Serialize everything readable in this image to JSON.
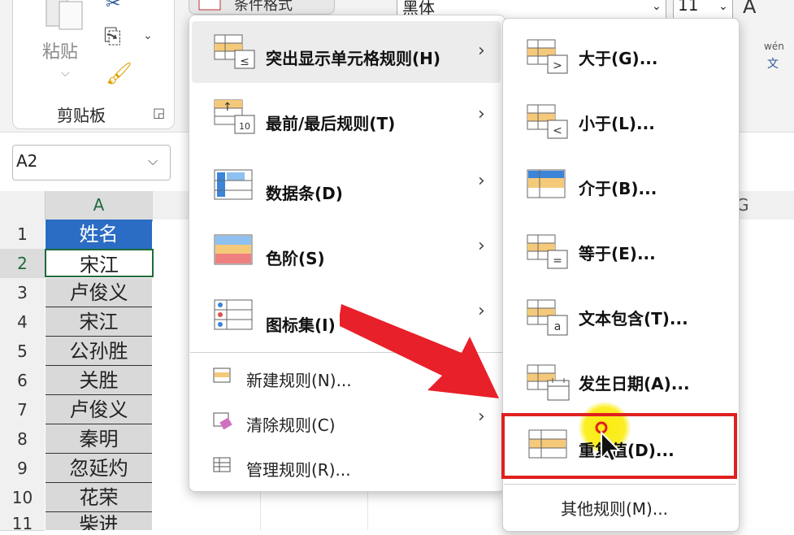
{
  "ribbon": {
    "clipboard": {
      "paste_label": "粘贴",
      "title": "剪贴板"
    },
    "conditional_format_label": "条件格式",
    "font_name": "黑体",
    "font_size": "11",
    "phonetic_top": "wén",
    "phonetic_bottom": "文"
  },
  "name_box": {
    "value": "A2"
  },
  "grid": {
    "col_a": "A",
    "col_g": "G",
    "rows": [
      {
        "num": "1",
        "value": "姓名"
      },
      {
        "num": "2",
        "value": "宋江"
      },
      {
        "num": "3",
        "value": "卢俊义"
      },
      {
        "num": "4",
        "value": "宋江"
      },
      {
        "num": "5",
        "value": "公孙胜"
      },
      {
        "num": "6",
        "value": "关胜"
      },
      {
        "num": "7",
        "value": "卢俊义"
      },
      {
        "num": "8",
        "value": "秦明"
      },
      {
        "num": "9",
        "value": "忽延灼"
      },
      {
        "num": "10",
        "value": "花荣"
      },
      {
        "num": "11",
        "value": "柴进"
      }
    ]
  },
  "menu": {
    "items": [
      {
        "label": "突出显示单元格规则(H)",
        "hotkey": "H"
      },
      {
        "label": "最前/最后规则(T)",
        "hotkey": "T"
      },
      {
        "label": "数据条(D)",
        "hotkey": "D"
      },
      {
        "label": "色阶(S)",
        "hotkey": "S"
      },
      {
        "label": "图标集(I)",
        "hotkey": "I"
      }
    ],
    "rules": [
      {
        "label": "新建规则(N)..."
      },
      {
        "label": "清除规则(C)"
      },
      {
        "label": "管理规则(R)..."
      }
    ]
  },
  "submenu": {
    "items": [
      {
        "label": "大于(G)..."
      },
      {
        "label": "小于(L)..."
      },
      {
        "label": "介于(B)..."
      },
      {
        "label": "等于(E)..."
      },
      {
        "label": "文本包含(T)..."
      },
      {
        "label": "发生日期(A)..."
      },
      {
        "label": "重复值(D)..."
      }
    ],
    "more": "其他规则(M)..."
  },
  "colors": {
    "accent": "#2b6cc4",
    "highlight_box": "#e02020",
    "arrow": "#e8202a",
    "cursor_dot": "#f5e000"
  }
}
